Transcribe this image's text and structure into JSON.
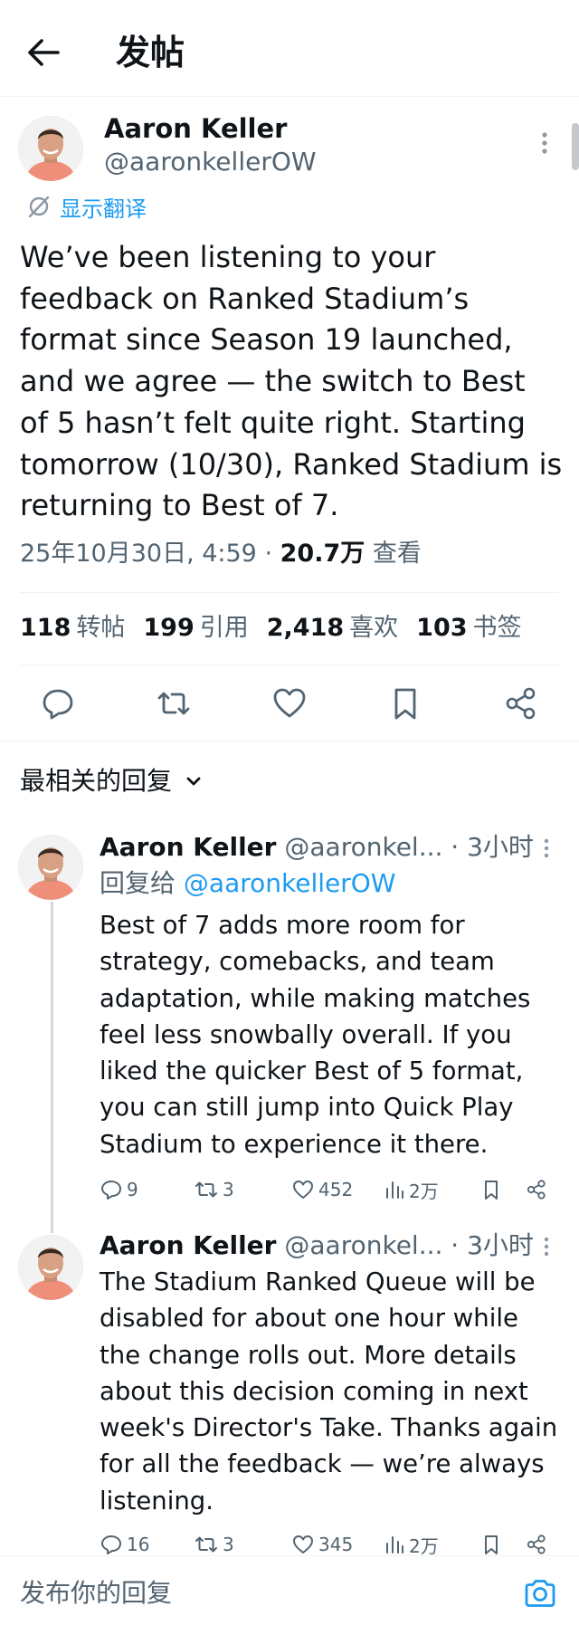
{
  "header": {
    "title": "发帖"
  },
  "icons": {
    "back": "arrow-left-icon",
    "more": "more-vertical-icon",
    "translate": "translate-icon",
    "reply": "reply-icon",
    "retweet": "retweet-icon",
    "like": "heart-icon",
    "bookmark": "bookmark-icon",
    "share": "share-icon",
    "views": "views-icon",
    "camera": "camera-icon",
    "chevron": "chevron-down-icon"
  },
  "colors": {
    "accent": "#1d9bf0",
    "text": "#0f1419",
    "muted": "#536471",
    "divider": "#eff3f4"
  },
  "main_post": {
    "name": "Aaron Keller",
    "handle": "@aaronkellerOW",
    "translate_label": "显示翻译",
    "text_lines": [
      "We’ve been listening to your",
      "feedback on Ranked Stadium’s",
      "format since Season 19 launched,",
      "and we agree — the switch to Best",
      "of 5 hasn’t felt quite right. Starting",
      "tomorrow (10/30), Ranked Stadium is",
      "returning to Best of 7."
    ],
    "timestamp": "25年10月30日, 4:59",
    "separator": " · ",
    "views": "20.7万",
    "views_label": " 查看",
    "stats": [
      {
        "count": "118",
        "label": "转帖"
      },
      {
        "count": "199",
        "label": "引用"
      },
      {
        "count": "2,418",
        "label": "喜欢"
      },
      {
        "count": "103",
        "label": "书签"
      }
    ]
  },
  "sort": {
    "label": "最相关的回复"
  },
  "replies": [
    {
      "name": "Aaron Keller",
      "handle": "@aaronkel...",
      "time": " · 3小时",
      "reply_to_prefix": "回复给 ",
      "reply_to": "@aaronkellerOW",
      "text_lines": [
        "Best of 7 adds more room for",
        "strategy, comebacks, and team",
        "adaptation, while making matches",
        "feel less snowbally overall. If you",
        "liked the quicker Best of 5 format,",
        "you can still jump into Quick Play",
        "Stadium to experience it there."
      ],
      "replies": "9",
      "retweets": "3",
      "likes": "452",
      "views": "2万"
    },
    {
      "name": "Aaron Keller",
      "handle": "@aaronkel...",
      "time": " · 3小时",
      "text_lines": [
        "The Stadium Ranked Queue will be",
        "disabled for about one hour while",
        "the change rolls out. More details",
        "about this decision coming in next",
        "week's Director's Take. Thanks again",
        "for all the feedback — we’re always",
        "listening."
      ],
      "replies": "16",
      "retweets": "3",
      "likes": "345",
      "views": "2万"
    }
  ],
  "compose": {
    "placeholder": "发布你的回复"
  }
}
